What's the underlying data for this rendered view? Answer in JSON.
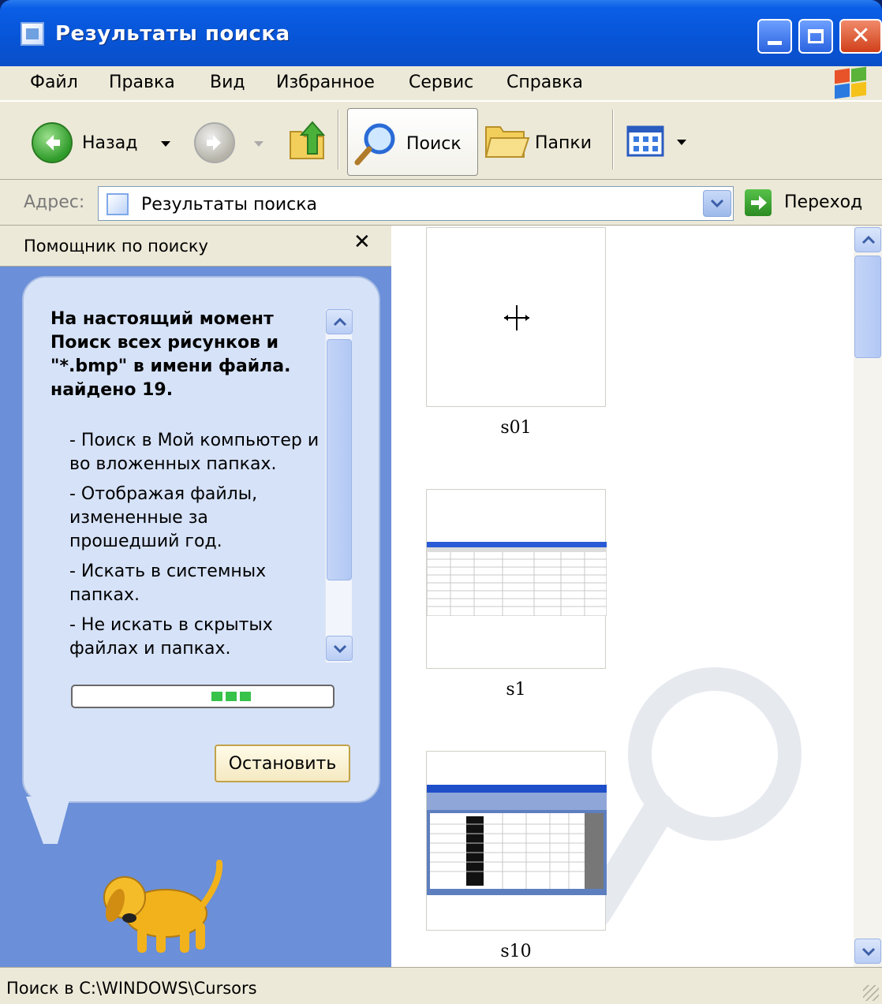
{
  "window": {
    "title": "Результаты поиска",
    "buttons": {
      "minimize": "minimize",
      "maximize": "maximize",
      "close": "close"
    }
  },
  "menu": [
    "Файл",
    "Правка",
    "Вид",
    "Избранное",
    "Сервис",
    "Справка"
  ],
  "toolbar": {
    "back_label": "Назад",
    "search_label": "Поиск",
    "folders_label": "Папки"
  },
  "address": {
    "label": "Адрес:",
    "value": "Результаты поиска",
    "go_label": "Переход"
  },
  "assistant": {
    "title": "Помощник по поиску",
    "heading": "На настоящий момент Поиск всех рисунков и \"*.bmp\" в имени файла. найдено 19.",
    "options": [
      "- Поиск в Мой компьютер и во вложенных папках.",
      "- Отображая файлы, измененные за прошедший год.",
      "- Искать в системных папках.",
      "- Не искать в скрытых файлах и папках."
    ],
    "stop_label": "Остановить"
  },
  "results": [
    {
      "name": "s01",
      "preview": "cursor-crosshair"
    },
    {
      "name": "s1",
      "preview": "spreadsheet-screenshot"
    },
    {
      "name": "s10",
      "preview": "spreadsheet-window-screenshot"
    }
  ],
  "status": {
    "text": "Поиск в C:\\WINDOWS\\Cursors"
  },
  "colors": {
    "titlebar": "#0754d6",
    "menubar": "#ece9d8",
    "assistant_bg": "#6b8fd8",
    "balloon": "#d6e2f8",
    "progress": "#37c24a"
  }
}
